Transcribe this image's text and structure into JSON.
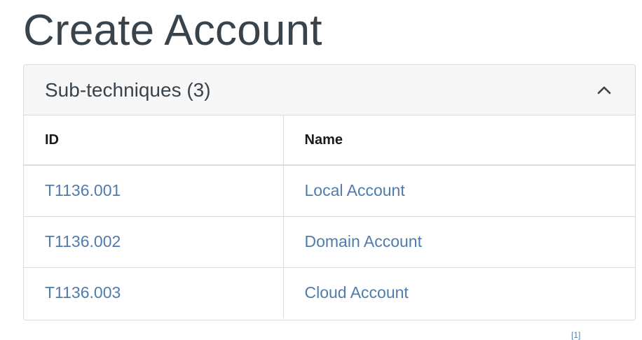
{
  "page": {
    "title": "Create Account"
  },
  "subtechniques": {
    "header_label": "Sub-techniques (3)",
    "columns": [
      "ID",
      "Name"
    ],
    "rows": [
      {
        "id": "T1136.001",
        "name": "Local Account"
      },
      {
        "id": "T1136.002",
        "name": "Domain Account"
      },
      {
        "id": "T1136.003",
        "name": "Cloud Account"
      }
    ],
    "toggle_icon": "chevron-up-icon"
  },
  "footnote": {
    "label": "[1]"
  },
  "colors": {
    "link": "#4f7cac",
    "title": "#39434c",
    "header_bg": "#f7f7f7",
    "border": "#dcdcdc"
  }
}
